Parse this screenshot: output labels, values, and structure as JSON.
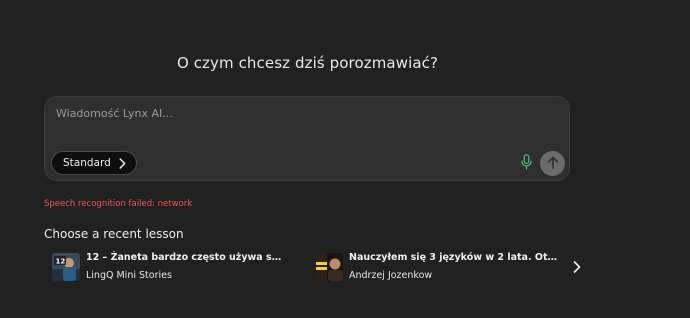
{
  "heading": {
    "text": "O czym chcesz dziś porozmawiać?"
  },
  "composer": {
    "placeholder": "Wiadomość Lynx AI...",
    "mode_label": "Standard"
  },
  "error": {
    "text": "Speech recognition failed: network"
  },
  "recent": {
    "title": "Choose a recent lesson",
    "lessons": [
      {
        "title": "12 – Żaneta bardzo często używa swój...",
        "subtitle": "LingQ Mini Stories"
      },
      {
        "title": "Nauczyłem się 3 języków w 2 lata. Oto 13...",
        "subtitle": "Andrzej Jozenkow"
      }
    ]
  },
  "colors": {
    "background": "#212121",
    "composer": "#2f2f2f",
    "error": "#f25555",
    "mic": "#4fbf7a",
    "send_disabled": "#6b6b6b"
  }
}
